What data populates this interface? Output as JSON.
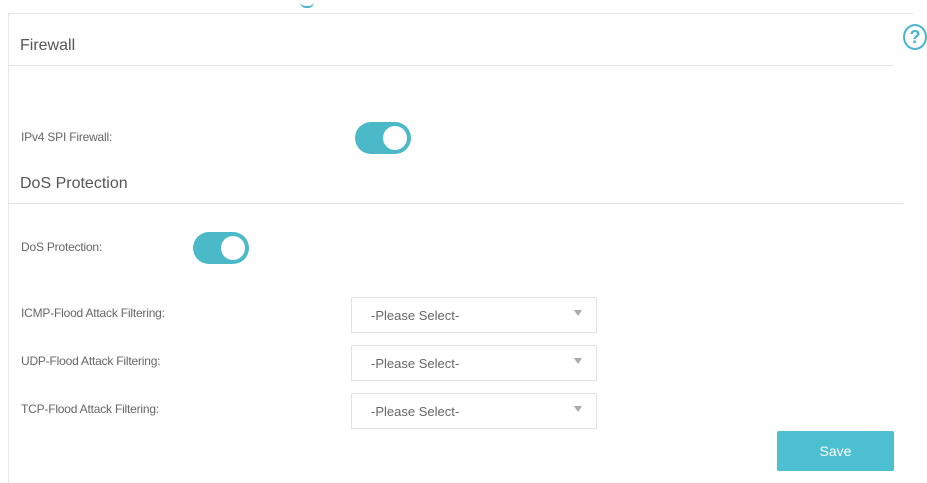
{
  "firewall": {
    "title": "Firewall",
    "ipv4_spi_label": "IPv4 SPI Firewall:",
    "ipv4_spi_enabled": true
  },
  "dos": {
    "title": "DoS Protection",
    "protection_label": "DoS Protection:",
    "protection_enabled": true,
    "filters": [
      {
        "label": "ICMP-Flood Attack Filtering:",
        "value": "-Please Select-"
      },
      {
        "label": "UDP-Flood Attack Filtering:",
        "value": "-Please Select-"
      },
      {
        "label": "TCP-Flood Attack Filtering:",
        "value": "-Please Select-"
      }
    ]
  },
  "actions": {
    "save_label": "Save"
  },
  "help": {
    "glyph": "?"
  },
  "colors": {
    "accent": "#4cb9c9",
    "button": "#4cbfd0"
  }
}
